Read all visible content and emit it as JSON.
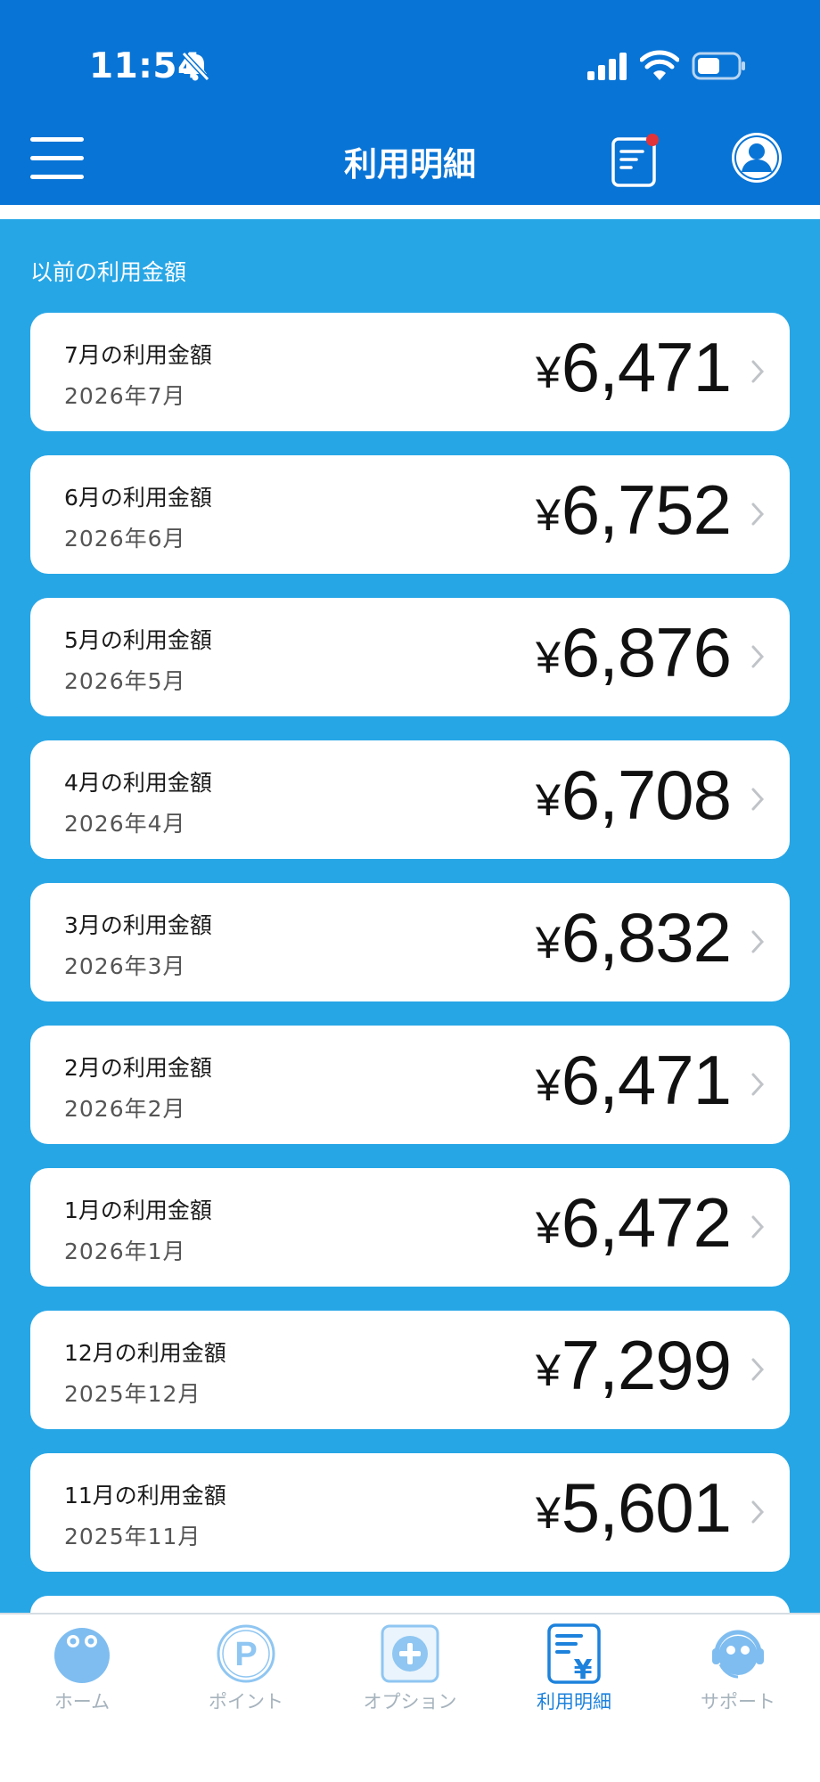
{
  "status_bar": {
    "time": "11:54",
    "icons": [
      "bell-slash-icon",
      "signal-icon",
      "wifi-icon",
      "battery-icon"
    ]
  },
  "header": {
    "title": "利用明細",
    "icons": [
      "menu-icon",
      "notice-icon",
      "profile-icon"
    ]
  },
  "section": {
    "title": "以前の利用金額"
  },
  "statements": [
    {
      "label": "7月の利用金額",
      "date": "2026年7月",
      "currency": "¥",
      "amount": "6,471"
    },
    {
      "label": "6月の利用金額",
      "date": "2026年6月",
      "currency": "¥",
      "amount": "6,752"
    },
    {
      "label": "5月の利用金額",
      "date": "2026年5月",
      "currency": "¥",
      "amount": "6,876"
    },
    {
      "label": "4月の利用金額",
      "date": "2026年4月",
      "currency": "¥",
      "amount": "6,708"
    },
    {
      "label": "3月の利用金額",
      "date": "2026年3月",
      "currency": "¥",
      "amount": "6,832"
    },
    {
      "label": "2月の利用金額",
      "date": "2026年2月",
      "currency": "¥",
      "amount": "6,471"
    },
    {
      "label": "1月の利用金額",
      "date": "2026年1月",
      "currency": "¥",
      "amount": "6,472"
    },
    {
      "label": "12月の利用金額",
      "date": "2025年12月",
      "currency": "¥",
      "amount": "7,299"
    },
    {
      "label": "11月の利用金額",
      "date": "2025年11月",
      "currency": "¥",
      "amount": "5,601"
    }
  ],
  "tabs": [
    {
      "label": "ホーム",
      "icon": "home-character-icon",
      "active": false
    },
    {
      "label": "ポイント",
      "icon": "point-icon",
      "active": false
    },
    {
      "label": "オプション",
      "icon": "option-plus-icon",
      "active": false
    },
    {
      "label": "利用明細",
      "icon": "statement-yen-icon",
      "active": true
    },
    {
      "label": "サポート",
      "icon": "support-headset-icon",
      "active": false
    }
  ],
  "colors": {
    "header_blue": "#0874d6",
    "content_blue": "#27a6e6",
    "tab_active": "#1d82dc",
    "tab_inactive": "#a6b3bd",
    "notification_dot": "#e0343a"
  }
}
